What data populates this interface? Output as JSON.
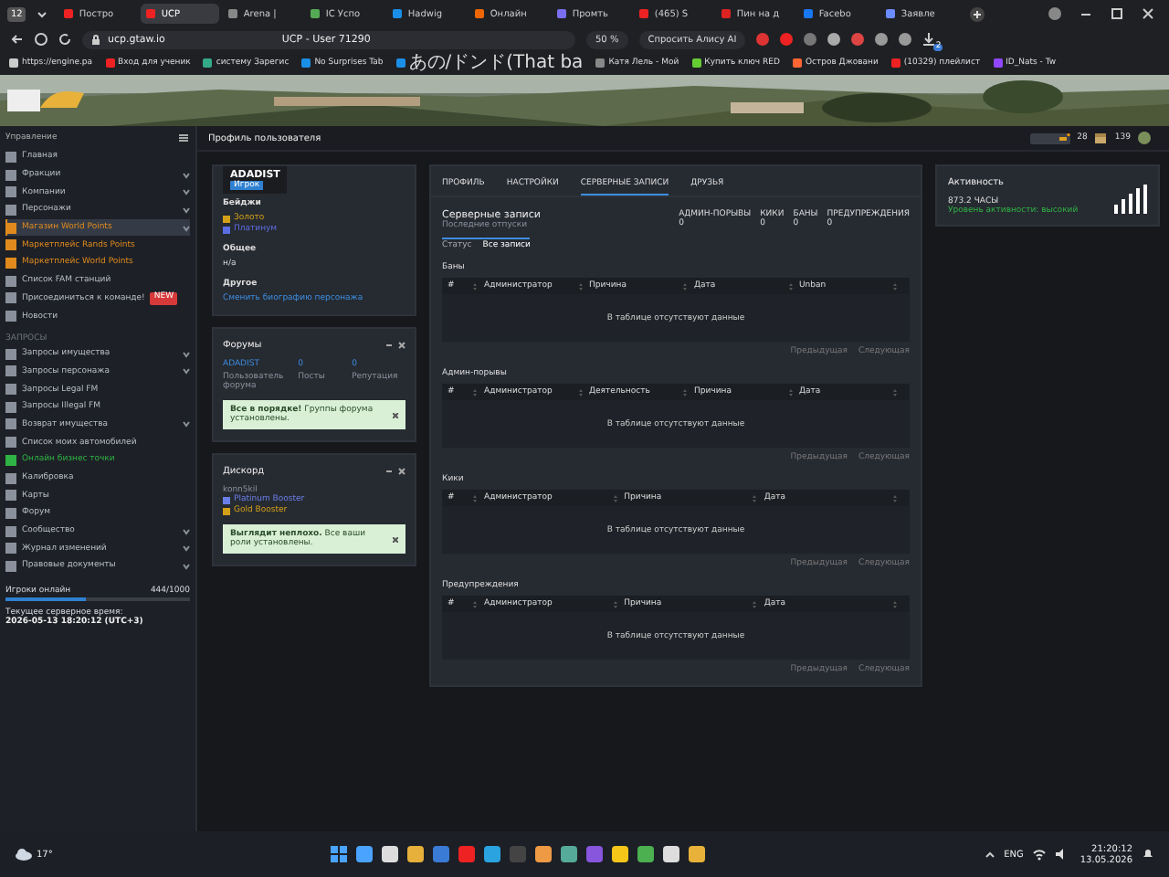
{
  "browser": {
    "tab_count": "12",
    "tabs": [
      {
        "label": "Постро",
        "selected": false
      },
      {
        "label": "UCP",
        "selected": true
      },
      {
        "label": "Arena |",
        "selected": false
      },
      {
        "label": "IC Успо",
        "selected": false
      },
      {
        "label": "Hadwig",
        "selected": false
      },
      {
        "label": "Онлайн",
        "selected": false
      },
      {
        "label": "Промть",
        "selected": false
      },
      {
        "label": "(465) S",
        "selected": false
      },
      {
        "label": "Пин на д",
        "selected": false
      },
      {
        "label": "Facebo",
        "selected": false
      },
      {
        "label": "Заявле",
        "selected": false
      }
    ],
    "address": "ucp.gtaw.io",
    "page_title": "UCP - User 71290",
    "zoom": "50 %",
    "assistant": "Спросить Алису AI",
    "downloads_badge": "2",
    "bookmarks": [
      "https://engine.pa",
      "Вход для ученик",
      "систему Зарегис",
      "No Surprises Tab",
      "あの/ドンド(That ba",
      "Катя Лель - Мой",
      "Купить ключ RED",
      "Остров Джовани",
      "(10329) плейлист",
      "ID_Nats - Tw"
    ]
  },
  "header": {
    "counter_1": "28",
    "counter_2": "139"
  },
  "sidebar": {
    "title": "Управление",
    "items": [
      {
        "label": "Главная",
        "expandable": false
      },
      {
        "label": "Фракции",
        "expandable": true
      },
      {
        "label": "Компании",
        "expandable": true
      },
      {
        "label": "Персонажи",
        "expandable": true
      },
      {
        "label": "Магазин World Points",
        "expandable": true,
        "color": "#e08a1e",
        "selected": true
      },
      {
        "label": "Маркетплейс Rands Points",
        "expandable": false,
        "color": "#e08a1e"
      },
      {
        "label": "Маркетплейс World Points",
        "expandable": false,
        "color": "#e08a1e"
      },
      {
        "label": "Список FAM станций",
        "expandable": false
      },
      {
        "label": "Присоединиться к команде!",
        "expandable": false,
        "badge": "NEW"
      },
      {
        "label": "Новости",
        "expandable": false
      }
    ],
    "section": "ЗАПРОСЫ",
    "items_2": [
      {
        "label": "Запросы имущества",
        "expandable": true
      },
      {
        "label": "Запросы персонажа",
        "expandable": true
      },
      {
        "label": "Запросы Legal FM",
        "expandable": false
      },
      {
        "label": "Запросы Illegal FM",
        "expandable": false
      },
      {
        "label": "Возврат имущества",
        "expandable": true
      },
      {
        "label": "Список моих автомобилей",
        "expandable": false
      },
      {
        "label": "Онлайн бизнес точки",
        "expandable": false,
        "color": "#2fb344"
      },
      {
        "label": "Калибровка",
        "expandable": false
      },
      {
        "label": "Карты",
        "expandable": false
      },
      {
        "label": "Форум",
        "expandable": false
      },
      {
        "label": "Сообщество",
        "expandable": true
      },
      {
        "label": "Журнал изменений",
        "expandable": true
      },
      {
        "label": "Правовые документы",
        "expandable": true
      }
    ],
    "online": {
      "label": "Игроки онлайн",
      "reading": "444/1000",
      "level": 0.44
    },
    "time_label": "Текущее серверное время:",
    "time": "2026-05-13 18:20:12 (UTC+3)"
  },
  "page_title": "Профиль пользователя",
  "profile": {
    "name": "ADADIST",
    "role": "Игрок",
    "badges_title": "Бейджи",
    "badges": [
      {
        "label": "Золото",
        "color": "#d4a017"
      },
      {
        "label": "Платинум",
        "color": "#5b6ee1"
      }
    ],
    "general_title": "Общее",
    "general_value": "н/а",
    "other_title": "Другое",
    "other_link": "Сменить биографию персонажа"
  },
  "forums": {
    "title": "Форумы",
    "user": "ADADIST",
    "user_label": "Пользователь форума",
    "posts": "0",
    "posts_label": "Посты",
    "rep": "0",
    "rep_label": "Репутация",
    "alert_bold": "Все в порядке!",
    "alert_text": "Группы форума установлены."
  },
  "discord": {
    "title": "Дискорд",
    "user": "konn5kil",
    "roles": [
      {
        "label": "Platinum Booster",
        "color": "#6b7fe8"
      },
      {
        "label": "Gold Booster",
        "color": "#d4a017"
      }
    ],
    "alert_bold": "Выглядит неплохо.",
    "alert_text": "Все ваши роли установлены."
  },
  "main": {
    "tabs": [
      {
        "label": "ПРОФИЛЬ",
        "selected": false
      },
      {
        "label": "НАСТРОЙКИ",
        "selected": false
      },
      {
        "label": "СЕРВЕРНЫЕ ЗАПИСИ",
        "selected": true
      },
      {
        "label": "ДРУЗЬЯ",
        "selected": false
      }
    ],
    "title": "Серверные записи",
    "subtitle": "Последние отпуски",
    "stats": [
      {
        "label": "АДМИН-ПОРЫВЫ",
        "value": "0"
      },
      {
        "label": "КИКИ",
        "value": "0"
      },
      {
        "label": "БАНЫ",
        "value": "0"
      },
      {
        "label": "ПРЕДУПРЕЖДЕНИЯ",
        "value": "0"
      }
    ],
    "subtabs": [
      {
        "label": "Статус",
        "selected": false
      },
      {
        "label": "Все записи",
        "selected": true
      }
    ],
    "tables": [
      {
        "title": "Баны",
        "columns": [
          "#",
          "Администратор",
          "Причина",
          "Дата",
          "Unban"
        ],
        "empty": "В таблице отсутствуют данные",
        "prev": "Предыдущая",
        "next": "Следующая"
      },
      {
        "title": "Админ-порывы",
        "columns": [
          "#",
          "Администратор",
          "Деятельность",
          "Причина",
          "Дата"
        ],
        "empty": "В таблице отсутствуют данные",
        "prev": "Предыдущая",
        "next": "Следующая"
      },
      {
        "title": "Кики",
        "columns": [
          "#",
          "Администратор",
          "Причина",
          "Дата"
        ],
        "empty": "В таблице отсутствуют данные",
        "prev": "Предыдущая",
        "next": "Следующая"
      },
      {
        "title": "Предупреждения",
        "columns": [
          "#",
          "Администратор",
          "Причина",
          "Дата"
        ],
        "empty": "В таблице отсутствуют данные",
        "prev": "Предыдущая",
        "next": "Следующая"
      }
    ]
  },
  "activity": {
    "title": "Активность",
    "hours": "873.2 ЧАСЫ",
    "note": "Уровень активности: высокий"
  },
  "taskbar": {
    "weather": "17°",
    "language": "ENG",
    "time": "21:20:12",
    "date": "13.05.2026"
  }
}
